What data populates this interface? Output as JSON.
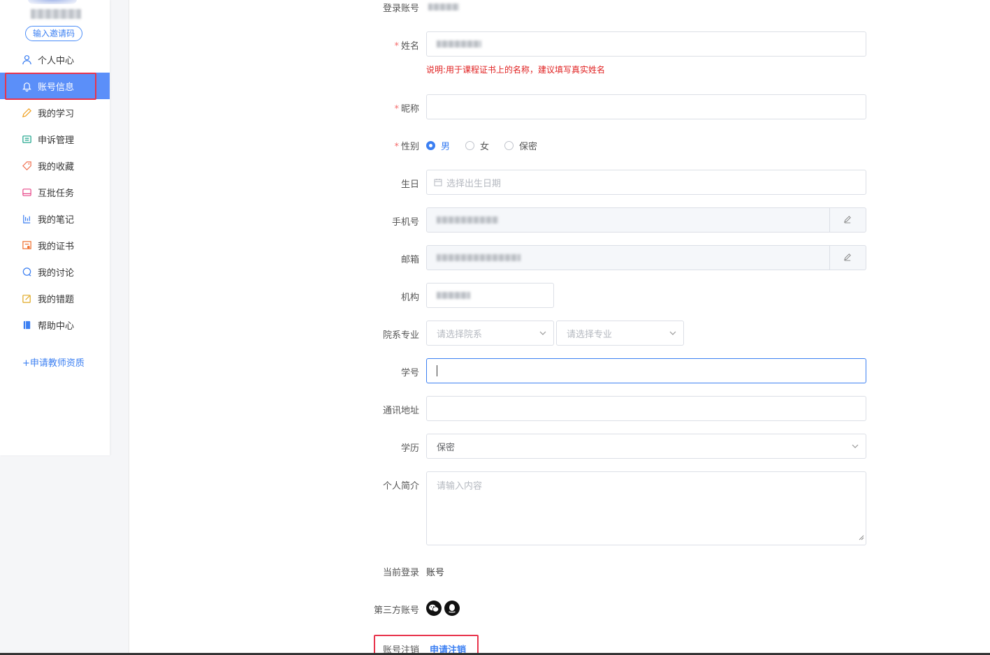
{
  "sidebar": {
    "invite_label": "输入邀请码",
    "items": [
      {
        "label": "个人中心",
        "icon": "user-icon",
        "active": false
      },
      {
        "label": "账号信息",
        "icon": "bell-icon",
        "active": true
      },
      {
        "label": "我的学习",
        "icon": "pencil-icon",
        "active": false
      },
      {
        "label": "申诉管理",
        "icon": "list-icon",
        "active": false
      },
      {
        "label": "我的收藏",
        "icon": "tag-icon",
        "active": false
      },
      {
        "label": "互批任务",
        "icon": "task-icon",
        "active": false
      },
      {
        "label": "我的笔记",
        "icon": "note-icon",
        "active": false
      },
      {
        "label": "我的证书",
        "icon": "certificate-icon",
        "active": false
      },
      {
        "label": "我的讨论",
        "icon": "chat-icon",
        "active": false
      },
      {
        "label": "我的错题",
        "icon": "edit-icon",
        "active": false
      },
      {
        "label": "帮助中心",
        "icon": "book-icon",
        "active": false
      }
    ],
    "apply_teacher": "+申请教师资质"
  },
  "form": {
    "login_account_label": "登录账号",
    "name_label": "姓名",
    "name_hint": "说明:用于课程证书上的名称，建议填写真实姓名",
    "nickname_label": "昵称",
    "gender_label": "性别",
    "gender_options": [
      "男",
      "女",
      "保密"
    ],
    "gender_selected": "男",
    "birthday_label": "生日",
    "birthday_placeholder": "选择出生日期",
    "phone_label": "手机号",
    "email_label": "邮箱",
    "org_label": "机构",
    "dept_label": "院系专业",
    "dept_placeholder": "请选择院系",
    "major_placeholder": "请选择专业",
    "student_id_label": "学号",
    "address_label": "通讯地址",
    "education_label": "学历",
    "education_value": "保密",
    "bio_label": "个人简介",
    "bio_placeholder": "请输入内容",
    "current_login_label": "当前登录",
    "current_login_value": "账号",
    "third_party_label": "第三方账号",
    "third_party_icons": [
      "wechat-icon",
      "qq-icon"
    ],
    "cancel_label": "账号注销",
    "cancel_link": "申请注销"
  },
  "colors": {
    "accent": "#3b7ff2",
    "active_nav": "#5b8ff9",
    "highlight_border": "#e8344c",
    "required": "#f56c6c",
    "hint": "#e02020"
  }
}
